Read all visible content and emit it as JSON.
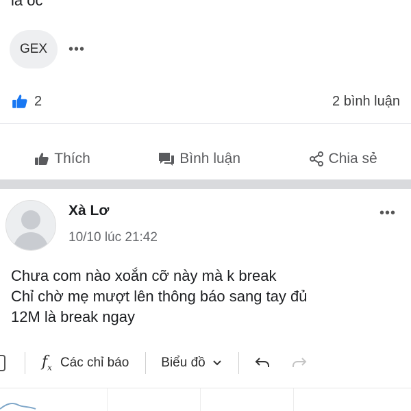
{
  "previous_post": {
    "cropped_text": "là oc",
    "chip_label": "GEX",
    "more_label": "•••",
    "like_count": "2",
    "comment_count": "2 bình luận"
  },
  "actions": {
    "like": "Thích",
    "comment": "Bình luận",
    "share": "Chia sẻ"
  },
  "post": {
    "author": "Xà Lơ",
    "time": "10/10 lúc 21:42",
    "more_label": "•••",
    "lines": [
      "Chưa com nào xoắn cỡ này mà k break",
      "Chỉ chờ mẹ mượt lên thông báo sang tay đủ",
      "12M là break ngay"
    ]
  },
  "embedded_toolbar": {
    "indicators": "Các chỉ báo",
    "chart": "Biểu đồ"
  },
  "colors": {
    "like_blue": "#1877f2",
    "separator": "#d9dadd",
    "secondary_text": "#65676b"
  }
}
